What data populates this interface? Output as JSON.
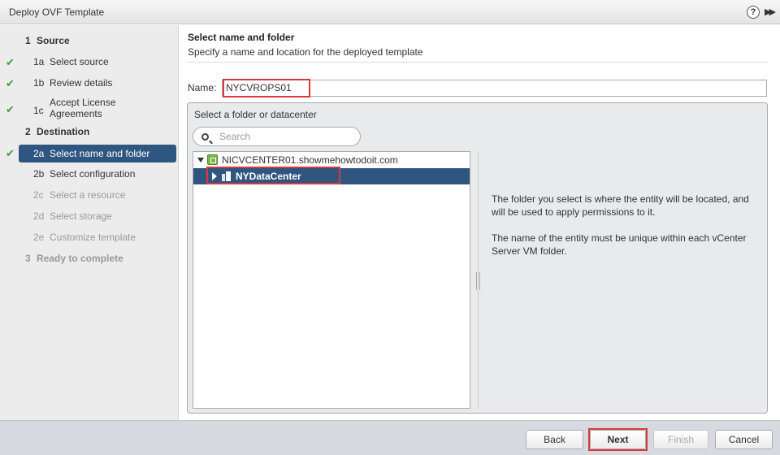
{
  "window": {
    "title": "Deploy OVF Template",
    "help_label": "?",
    "collapse_label": "▶▶"
  },
  "steps": [
    {
      "num": "1",
      "label": "Source",
      "kind": "section"
    },
    {
      "num": "1a",
      "label": "Select source",
      "status": "done"
    },
    {
      "num": "1b",
      "label": "Review details",
      "status": "done"
    },
    {
      "num": "1c",
      "label": "Accept License Agreements",
      "status": "done"
    },
    {
      "num": "2",
      "label": "Destination",
      "kind": "section"
    },
    {
      "num": "2a",
      "label": "Select name and folder",
      "status": "current"
    },
    {
      "num": "2b",
      "label": "Select configuration",
      "status": "available"
    },
    {
      "num": "2c",
      "label": "Select a resource",
      "status": "disabled"
    },
    {
      "num": "2d",
      "label": "Select storage",
      "status": "disabled"
    },
    {
      "num": "2e",
      "label": "Customize template",
      "status": "disabled"
    },
    {
      "num": "3",
      "label": "Ready to complete",
      "kind": "section",
      "status": "disabled"
    }
  ],
  "page": {
    "heading": "Select name and folder",
    "subheading": "Specify a name and location for the deployed template"
  },
  "name_field": {
    "label": "Name:",
    "value": "NYCVROPS01"
  },
  "folder_panel": {
    "title": "Select a folder or datacenter",
    "search_placeholder": "Search",
    "tree": [
      {
        "label": "NICVCENTER01.showmehowtodoit.com",
        "icon": "vcenter-icon",
        "expanded": true
      },
      {
        "label": "NYDataCenter",
        "icon": "datacenter-icon",
        "selected": true
      }
    ],
    "info_paragraphs": [
      "The folder you select is where the entity will be located, and will be used to apply permissions to it.",
      "The name of the entity must be unique within each vCenter Server VM folder."
    ]
  },
  "footer": {
    "back": "Back",
    "next": "Next",
    "finish": "Finish",
    "cancel": "Cancel"
  },
  "colors": {
    "selection": "#2f5680",
    "check": "#3ca03c",
    "highlight_box": "#d9393c"
  }
}
